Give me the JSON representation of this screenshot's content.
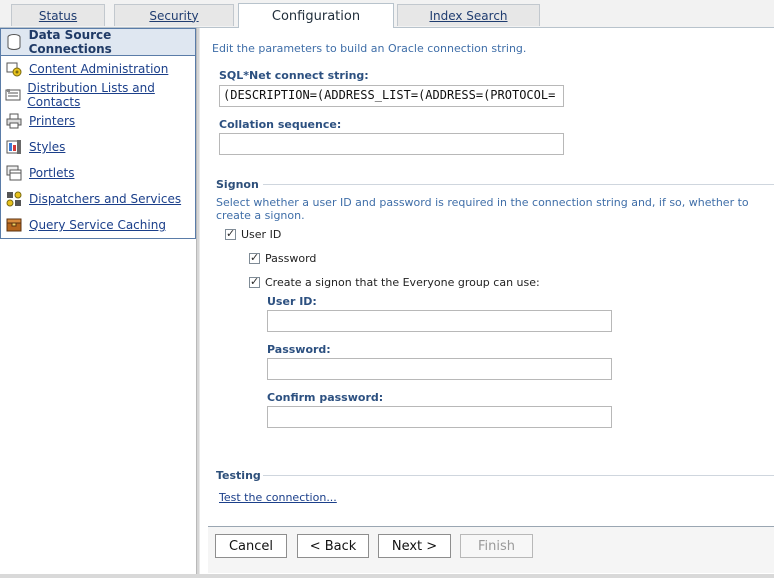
{
  "tabs": [
    {
      "label": "Status",
      "active": false
    },
    {
      "label": "Security",
      "active": false
    },
    {
      "label": "Configuration",
      "active": true
    },
    {
      "label": "Index Search",
      "active": false
    }
  ],
  "sidebar": {
    "items": [
      {
        "label": "Data Source Connections",
        "icon": "database-icon",
        "selected": true
      },
      {
        "label": "Content Administration",
        "icon": "content-admin-icon",
        "selected": false
      },
      {
        "label": "Distribution Lists and Contacts",
        "icon": "address-book-icon",
        "selected": false
      },
      {
        "label": "Printers",
        "icon": "printer-icon",
        "selected": false
      },
      {
        "label": "Styles",
        "icon": "styles-icon",
        "selected": false
      },
      {
        "label": "Portlets",
        "icon": "portlets-icon",
        "selected": false
      },
      {
        "label": "Dispatchers and Services",
        "icon": "dispatchers-icon",
        "selected": false
      },
      {
        "label": "Query Service Caching",
        "icon": "cache-icon",
        "selected": false
      }
    ]
  },
  "main": {
    "intro": "Edit the parameters to build an Oracle connection string.",
    "sqlnet_label": "SQL*Net connect string:",
    "sqlnet_value": "(DESCRIPTION=(ADDRESS_LIST=(ADDRESS=(PROTOCOL=",
    "collation_label": "Collation sequence:",
    "collation_value": "",
    "signon": {
      "title": "Signon",
      "help": "Select whether a user ID and password is required in the connection string and, if so, whether to create a signon.",
      "user_id_check_label": "User ID",
      "user_id_checked": true,
      "password_check_label": "Password",
      "password_checked": true,
      "everyone_check_label": "Create a signon that the Everyone group can use:",
      "everyone_checked": true,
      "user_id_field_label": "User ID:",
      "user_id_value": "",
      "password_field_label": "Password:",
      "password_value": "",
      "confirm_field_label": "Confirm password:",
      "confirm_value": ""
    },
    "testing": {
      "title": "Testing",
      "link": "Test the connection..."
    }
  },
  "footer": {
    "cancel": "Cancel",
    "back": "< Back",
    "next": "Next >",
    "finish": "Finish",
    "finish_disabled": true
  },
  "colors": {
    "link": "#1b3f8a",
    "label": "#2c5080",
    "help_text": "#3f6ea8",
    "selected_bg": "#dfe7f1"
  }
}
